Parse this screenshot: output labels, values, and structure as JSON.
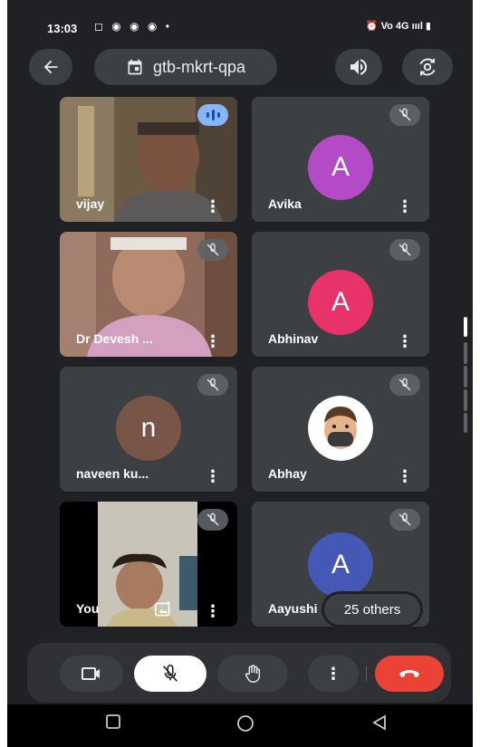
{
  "status_bar": {
    "time": "13:03",
    "notification_icons": "◻ ◉ ◉ ◉ •",
    "right": "⏰ Vo 4G ıııl ▮"
  },
  "header": {
    "meeting_code": "gtb-mkrt-qpa"
  },
  "tiles": [
    {
      "name": "vijay",
      "type": "video",
      "speaking": true
    },
    {
      "name": "Avika",
      "type": "avatar",
      "initial": "A",
      "color": "#b34bc6",
      "muted": true
    },
    {
      "name": "Dr Devesh ...",
      "type": "video",
      "muted": true
    },
    {
      "name": "Abhinav",
      "type": "avatar",
      "initial": "A",
      "color": "#e8336a",
      "muted": true
    },
    {
      "name": "naveen ku...",
      "type": "avatar",
      "initial": "n",
      "color": "#795548",
      "muted": true
    },
    {
      "name": "Abhay",
      "type": "emoji-avatar",
      "muted": true
    },
    {
      "name": "You",
      "type": "video",
      "muted": true
    },
    {
      "name": "Aayushi",
      "type": "avatar",
      "initial": "A",
      "color": "#4558b5",
      "muted": true
    }
  ],
  "others_chip": {
    "label": "25 others"
  },
  "colors": {
    "end_call": "#ea4335",
    "background": "#202124",
    "tile": "#3c4043"
  }
}
